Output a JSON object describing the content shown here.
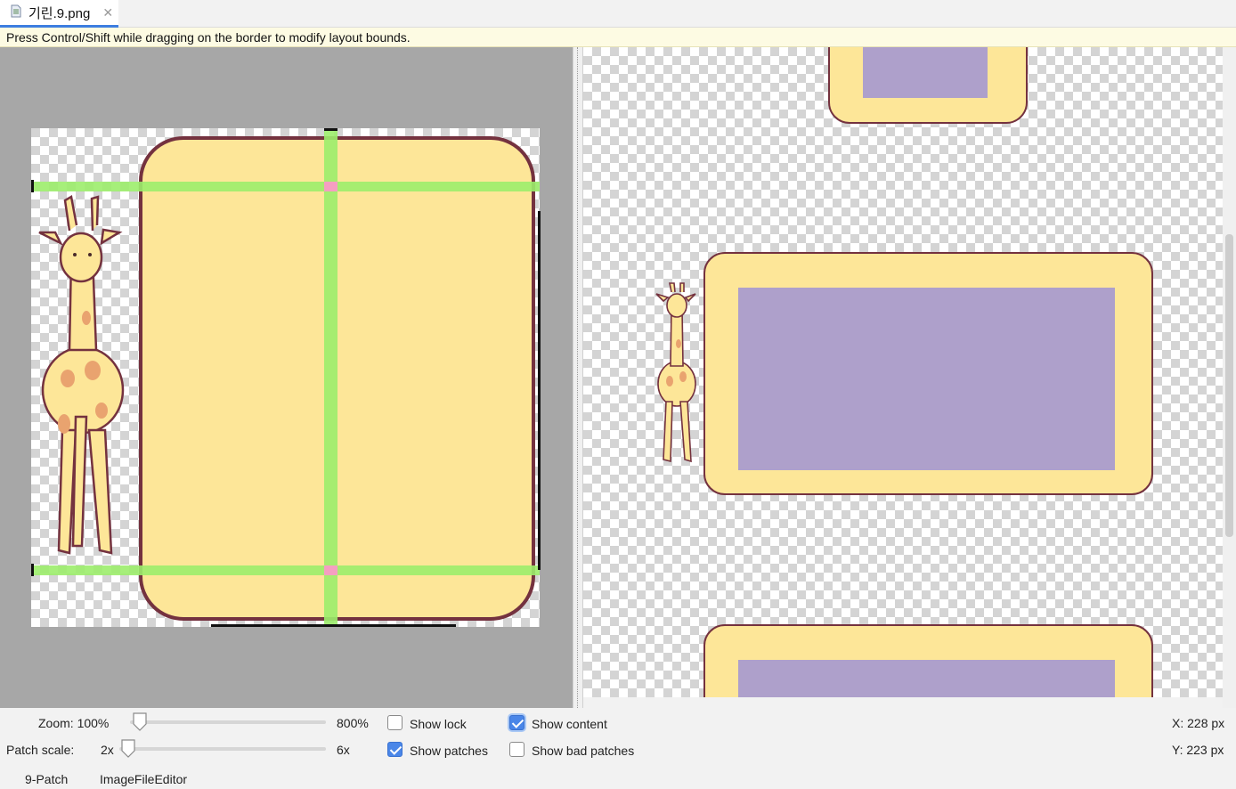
{
  "tab": {
    "filename": "기린.9.png",
    "close_glyph": "✕",
    "icon": "file-icon"
  },
  "hint": "Press Control/Shift while dragging on the border to modify layout bounds.",
  "controls": {
    "zoom_label": "Zoom: 100%",
    "zoom_max": "800%",
    "zoom_value": 100,
    "patch_scale_label": "Patch scale:",
    "patch_scale_min": "2x",
    "patch_scale_max": "6x",
    "patch_scale_value": 2,
    "show_lock": {
      "label": "Show lock",
      "checked": false
    },
    "show_patches": {
      "label": "Show patches",
      "checked": true
    },
    "show_content": {
      "label": "Show content",
      "checked": true
    },
    "show_bad_patches": {
      "label": "Show bad patches",
      "checked": false
    },
    "x_readout": "X: 228 px",
    "y_readout": "Y: 223 px"
  },
  "bottom_tabs": [
    "9-Patch",
    "ImageFileEditor"
  ],
  "colors": {
    "panel_fill": "#fde698",
    "panel_border": "#74323f",
    "content_fill": "#aea0cb",
    "patch_guide": "#9ced6c",
    "patch_cross": "#f59fc1",
    "editor_bg": "#a7a7a7"
  }
}
